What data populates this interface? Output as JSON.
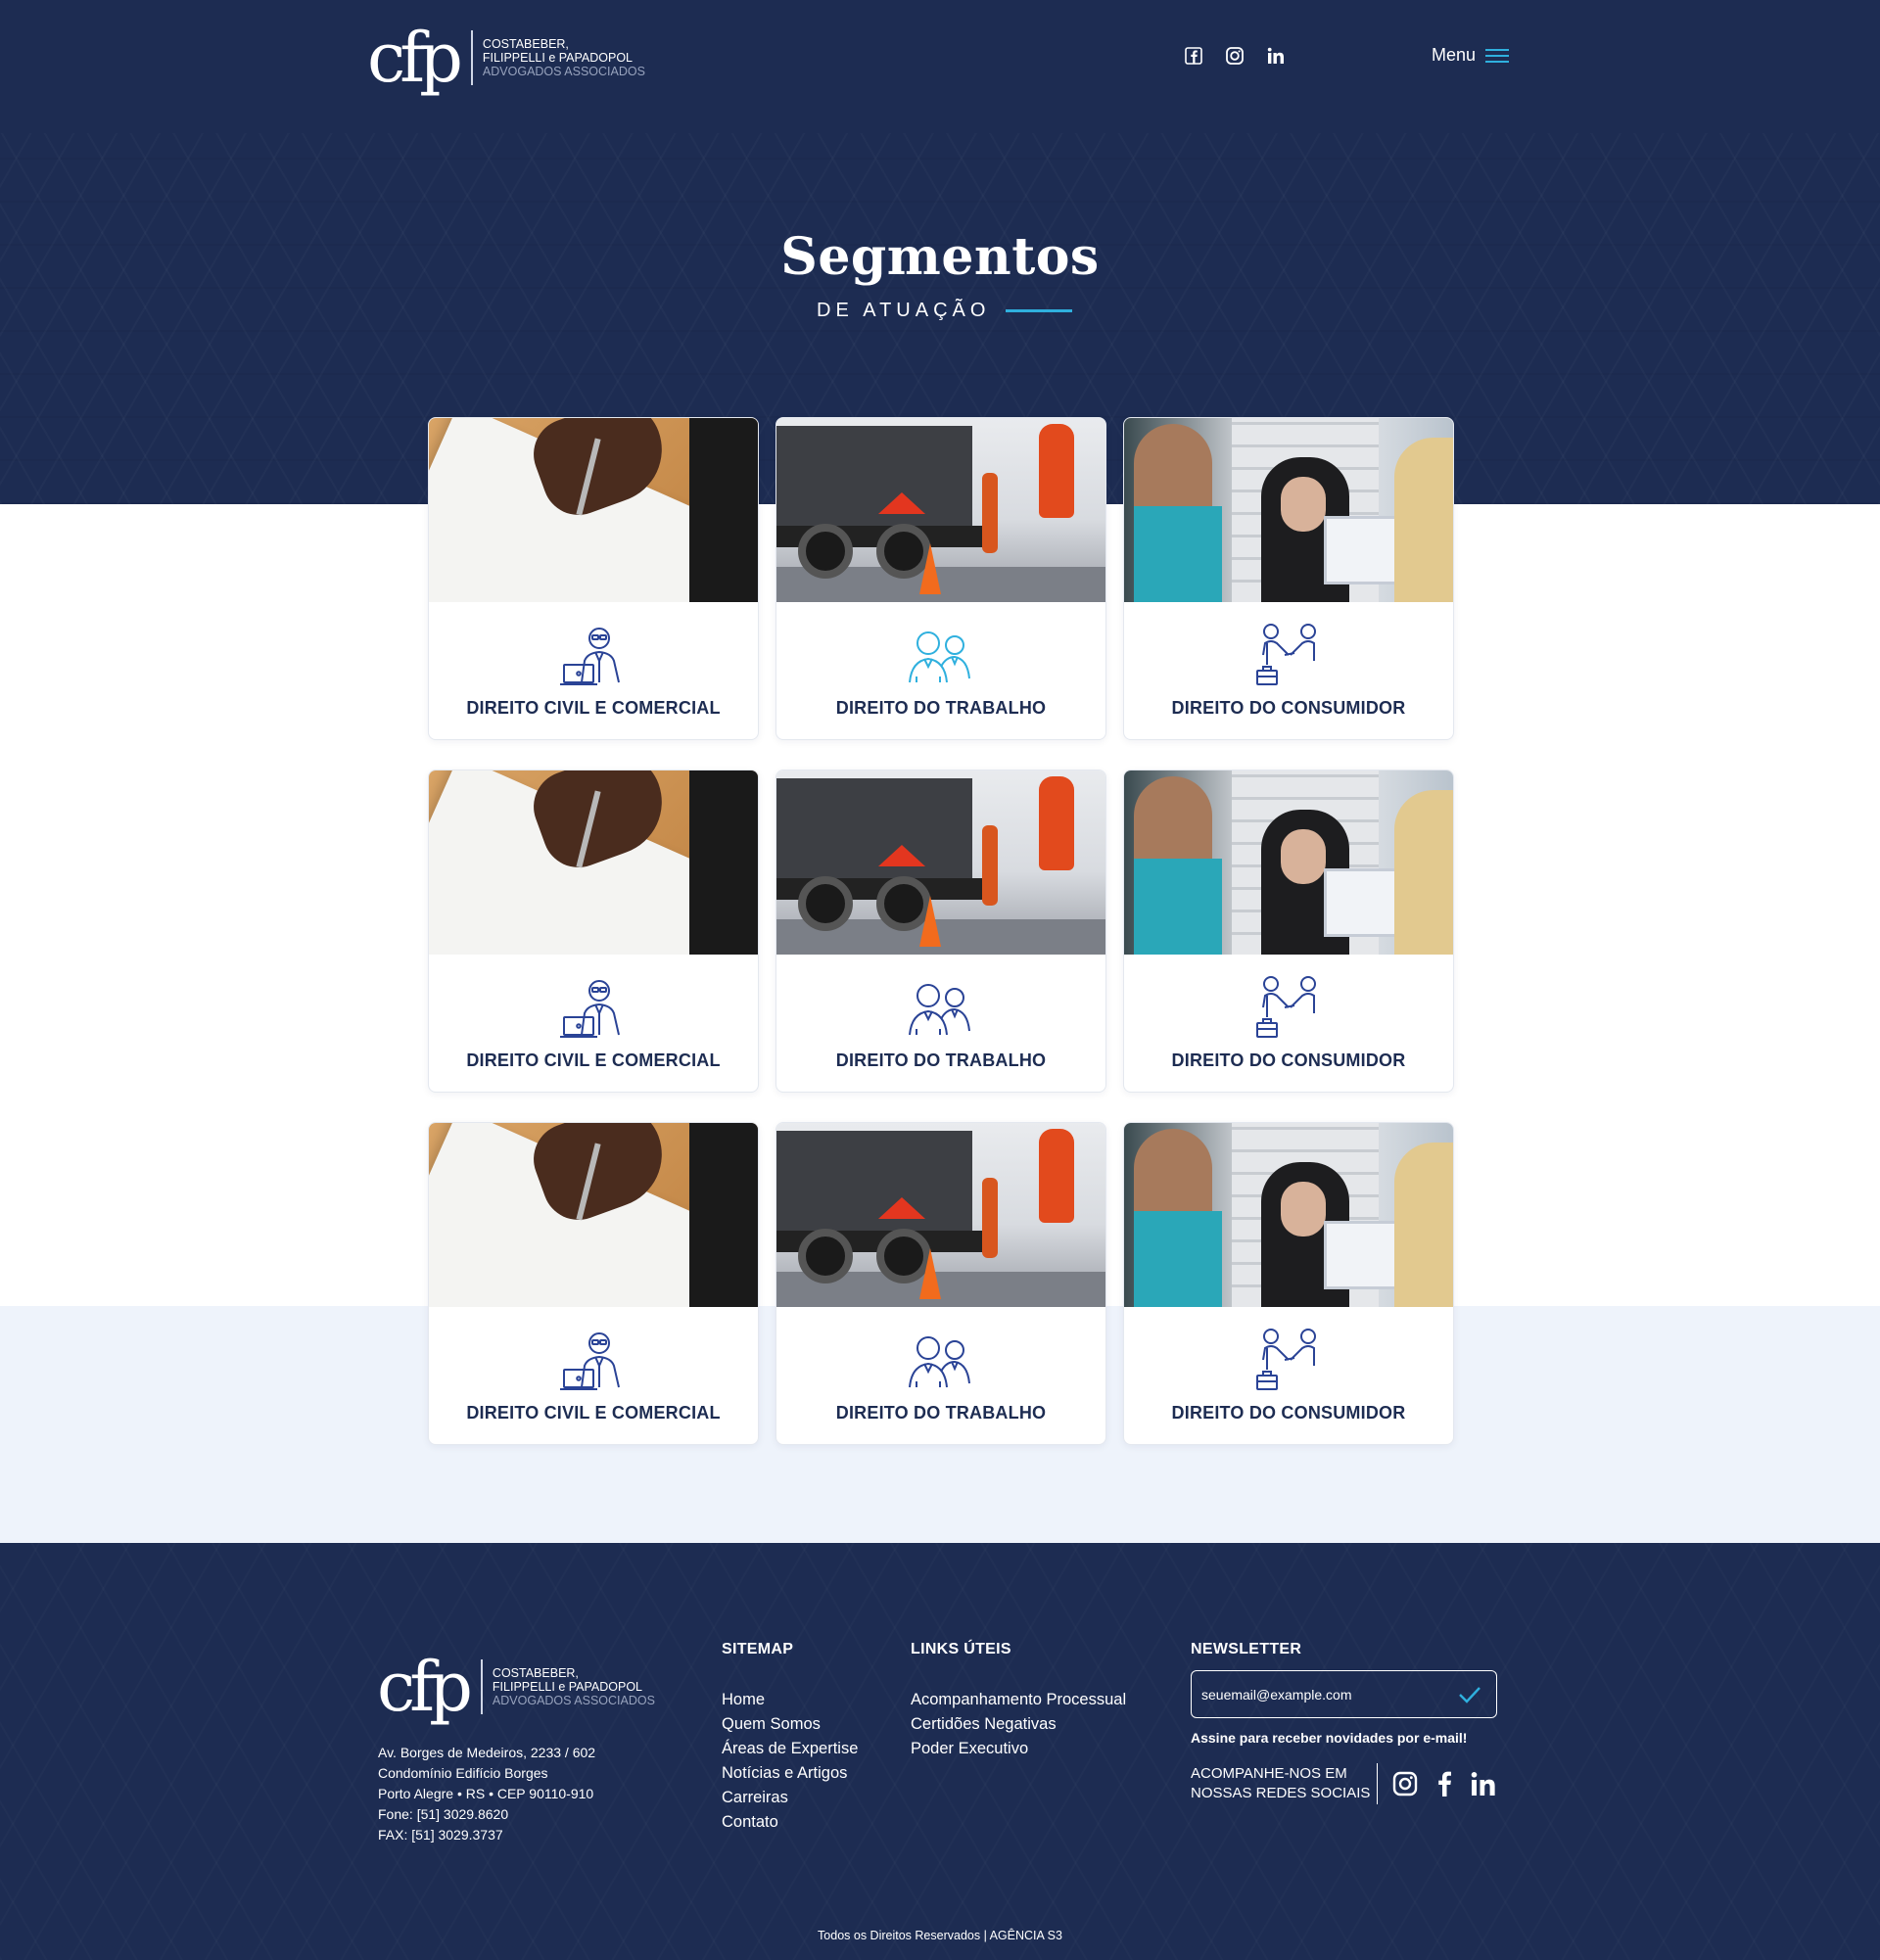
{
  "header": {
    "logo_mark": "cfp",
    "logo_line1": "COSTABEBER,",
    "logo_line2": "FILIPPELLI e PAPADOPOL",
    "logo_line3": "ADVOGADOS ASSOCIADOS",
    "social_icons": [
      "facebook-icon",
      "instagram-icon",
      "linkedin-icon"
    ],
    "menu_label": "Menu"
  },
  "hero": {
    "title": "Segmentos",
    "subtitle": "DE ATUAÇÃO"
  },
  "cards": [
    {
      "label": "DIREITO CIVIL E COMERCIAL",
      "icon": "lawyer-laptop-icon",
      "photo": "signing-document"
    },
    {
      "label": "DIREITO DO TRABALHO",
      "icon": "workers-icon",
      "photo": "truck-worker"
    },
    {
      "label": "DIREITO DO CONSUMIDOR",
      "icon": "handshake-icon",
      "photo": "consumer-shop"
    },
    {
      "label": "DIREITO CIVIL E COMERCIAL",
      "icon": "lawyer-laptop-icon",
      "photo": "signing-document"
    },
    {
      "label": "DIREITO DO TRABALHO",
      "icon": "workers-icon",
      "photo": "truck-worker"
    },
    {
      "label": "DIREITO DO CONSUMIDOR",
      "icon": "handshake-icon",
      "photo": "consumer-shop"
    },
    {
      "label": "DIREITO CIVIL E COMERCIAL",
      "icon": "lawyer-laptop-icon",
      "photo": "signing-document"
    },
    {
      "label": "DIREITO DO TRABALHO",
      "icon": "workers-icon",
      "photo": "truck-worker"
    },
    {
      "label": "DIREITO DO CONSUMIDOR",
      "icon": "handshake-icon",
      "photo": "consumer-shop"
    }
  ],
  "footer": {
    "address": [
      "Av. Borges de Medeiros, 2233 / 602",
      "Condomínio Edifício Borges",
      "Porto Alegre • RS • CEP 90110-910",
      "Fone: [51] 3029.8620",
      "FAX: [51] 3029.3737"
    ],
    "sitemap": {
      "title": "SITEMAP",
      "links": [
        "Home",
        "Quem Somos",
        "Áreas de Expertise",
        "Notícias e Artigos",
        "Carreiras",
        "Contato"
      ]
    },
    "useful": {
      "title": "LINKS ÚTEIS",
      "links": [
        "Acompanhamento Processual",
        "Certidões Negativas",
        "Poder Executivo"
      ]
    },
    "newsletter": {
      "title": "NEWSLETTER",
      "placeholder": "seuemail@example.com",
      "note": "Assine para receber novidades por e-mail!",
      "follow": "ACOMPANHE-NOS EM NOSSAS REDES SOCIAIS"
    },
    "copyright": "Todos os Direitos Reservados | AGÊNCIA S3"
  },
  "colors": {
    "navy": "#1d2c52",
    "accent": "#2fb0de",
    "light_band": "#eef3fb"
  }
}
